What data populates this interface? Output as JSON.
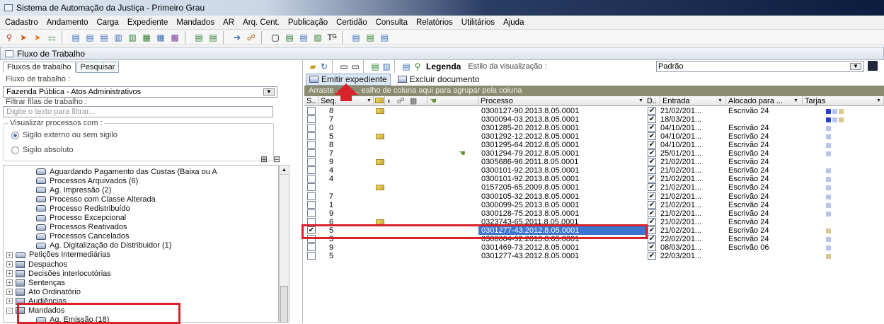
{
  "window": {
    "title": "Sistema de Automação da Justiça - Primeiro Grau"
  },
  "menu": [
    "Cadastro",
    "Andamento",
    "Carga",
    "Expediente",
    "Mandados",
    "AR",
    "Arq. Cent.",
    "Publicação",
    "Certidão",
    "Consulta",
    "Relatórios",
    "Utilitários",
    "Ajuda"
  ],
  "panel": {
    "title": "Fluxo de Trabalho"
  },
  "left": {
    "tabs": [
      "Fluxos de trabalho",
      "Pesquisar"
    ],
    "flow_label": "Fluxo de trabalho :",
    "flow_value": "Fazenda Pública - Atos Administrativos",
    "filter_label": "Filtrar filas de trabalho :",
    "filter_placeholder": "Digite o texto para filtrar...",
    "visualizar_label": "Visualizar processos com :",
    "radio_external": "Sigilo externo ou sem sigilo",
    "radio_absolute": "Sigilo absoluto",
    "tree": [
      {
        "label": "Aguardando Pagamento das Custas (Baixa ou A",
        "level": 2,
        "icon": "queue-icon"
      },
      {
        "label": "Processos Arquivados (6)",
        "level": 2,
        "icon": "queue-icon"
      },
      {
        "label": "Ag. Impressão (2)",
        "level": 2,
        "icon": "queue-icon"
      },
      {
        "label": "Processo com Classe Alterada",
        "level": 2,
        "icon": "queue-icon"
      },
      {
        "label": "Processo Redistribuído",
        "level": 2,
        "icon": "queue-icon"
      },
      {
        "label": "Processo Excepcional",
        "level": 2,
        "icon": "queue-icon"
      },
      {
        "label": "Processos Reativados",
        "level": 2,
        "icon": "queue-icon"
      },
      {
        "label": "Processos Cancelados",
        "level": 2,
        "icon": "queue-icon"
      },
      {
        "label": "Ag. Digitalização do Distribuidor (1)",
        "level": 2,
        "icon": "queue-icon"
      },
      {
        "label": "Petições Intermediárias",
        "level": 1,
        "icon": "queue-icon"
      },
      {
        "label": "Despachos",
        "level": 1,
        "icon": "folder-icon"
      },
      {
        "label": "Decisões interlocutórias",
        "level": 1,
        "icon": "folder-icon"
      },
      {
        "label": "Sentenças",
        "level": 1,
        "icon": "folder-icon"
      },
      {
        "label": "Ato Ordinatório",
        "level": 1,
        "icon": "folder-icon"
      },
      {
        "label": "Audiências",
        "level": 1,
        "icon": "folder-icon"
      },
      {
        "label": "Mandados",
        "level": 1,
        "icon": "folder-icon"
      },
      {
        "label": "Ag. Emissão (18)",
        "level": 2,
        "icon": "queue-icon"
      }
    ]
  },
  "right": {
    "legend_label": "Legenda",
    "style_label": "Estilo da visualização :",
    "style_value": "Padrão",
    "actions": {
      "emit": "Emitir expediente",
      "delete": "Excluir documento"
    },
    "group_hint": "Arraste ... ca... ealho de coluna aqui para agrupar pela coluna",
    "columns": {
      "s": "S..",
      "seq": "Seq.",
      "processo": "Processo",
      "d": "D..",
      "entrada": "Entrada",
      "alocado": "Alocado para ...",
      "tarjas": "Tarjas"
    },
    "rows": [
      {
        "checked": false,
        "seq": "8",
        "env": true,
        "proc": "0300127-90.2013.8.05.0001",
        "d": true,
        "entrada": "21/02/201...",
        "aloc": "Escrivão 24",
        "tarjas": [
          "#2a3fcf",
          "#b9c3f0",
          "#d8c98e"
        ]
      },
      {
        "checked": false,
        "seq": "7",
        "env": false,
        "proc": "0300094-03.2013.8.05.0001",
        "d": true,
        "entrada": "18/03/201...",
        "aloc": "",
        "tarjas": [
          "#2a3fcf",
          "#b9c3f0",
          "#d8c98e"
        ]
      },
      {
        "checked": false,
        "seq": "0",
        "env": false,
        "proc": "0301285-20.2012.8.05.0001",
        "d": true,
        "entrada": "04/10/201...",
        "aloc": "Escrivão 24",
        "tarjas": [
          "#b9c3f0"
        ]
      },
      {
        "checked": false,
        "seq": "5",
        "env": true,
        "proc": "0301292-12.2012.8.05.0001",
        "d": true,
        "entrada": "04/10/201...",
        "aloc": "Escrivão 24",
        "tarjas": [
          "#b9c3f0"
        ]
      },
      {
        "checked": false,
        "seq": "8",
        "env": false,
        "proc": "0301295-64.2012.8.05.0001",
        "d": true,
        "entrada": "04/10/201...",
        "aloc": "Escrivão 24",
        "tarjas": [
          "#b9c3f0"
        ]
      },
      {
        "checked": false,
        "seq": "7",
        "env": false,
        "hand": true,
        "proc": "0301294-79.2012.8.05.0001",
        "d": true,
        "entrada": "25/01/201...",
        "aloc": "Escrivão 24",
        "tarjas": [
          "#b9c3f0"
        ]
      },
      {
        "checked": false,
        "seq": "9",
        "env": true,
        "proc": "0305686-96.2011.8.05.0001",
        "d": true,
        "entrada": "21/02/201...",
        "aloc": "Escrivão 24",
        "tarjas": []
      },
      {
        "checked": false,
        "seq": "4",
        "env": false,
        "proc": "0300101-92.2013.8.05.0001",
        "d": true,
        "entrada": "21/02/201...",
        "aloc": "Escrivão 24",
        "tarjas": [
          "#b9c3f0"
        ]
      },
      {
        "checked": false,
        "seq": "4",
        "env": false,
        "proc": "0300101-92.2013.8.05.0001",
        "d": true,
        "entrada": "21/02/201...",
        "aloc": "Escrivão 24",
        "tarjas": [
          "#b9c3f0"
        ]
      },
      {
        "checked": false,
        "seq": "",
        "env": true,
        "proc": "0157205-65.2009.8.05.0001",
        "d": true,
        "entrada": "21/02/201...",
        "aloc": "Escrivão 24",
        "tarjas": [
          "#b9c3f0"
        ]
      },
      {
        "checked": false,
        "seq": "7",
        "env": false,
        "proc": "0300105-32.2013.8.05.0001",
        "d": true,
        "entrada": "21/02/201...",
        "aloc": "Escrivão 24",
        "tarjas": [
          "#b9c3f0"
        ]
      },
      {
        "checked": false,
        "seq": "1",
        "env": false,
        "proc": "0300099-25.2013.8.05.0001",
        "d": true,
        "entrada": "21/02/201...",
        "aloc": "Escrivão 24",
        "tarjas": [
          "#b9c3f0"
        ]
      },
      {
        "checked": false,
        "seq": "9",
        "env": false,
        "proc": "0300128-75.2013.8.05.0001",
        "d": true,
        "entrada": "21/02/201...",
        "aloc": "Escrivão 24",
        "tarjas": [
          "#b9c3f0"
        ]
      },
      {
        "checked": false,
        "seq": "6",
        "env": true,
        "proc": "0323743-65.2011.8.05.0001",
        "d": true,
        "entrada": "21/02/201...",
        "aloc": "Escrivão 24",
        "tarjas": []
      },
      {
        "checked": true,
        "seq": "5",
        "env": false,
        "proc": "0301277-43.2012.8.05.0001",
        "d": true,
        "entrada": "21/02/201...",
        "aloc": "Escrivão 24",
        "tarjas": [
          "#d8c98e"
        ],
        "selected": true
      },
      {
        "checked": false,
        "seq": "3",
        "env": false,
        "proc": "0300004-92.2013.8.05.0001",
        "d": true,
        "entrada": "22/02/201...",
        "aloc": "Escrivão 24",
        "tarjas": [
          "#b9c3f0"
        ]
      },
      {
        "checked": false,
        "seq": "9",
        "env": false,
        "proc": "0301469-73.2012.8.05.0001",
        "d": true,
        "entrada": "08/03/201...",
        "aloc": "Escrivão 06",
        "tarjas": [
          "#b9c3f0"
        ]
      },
      {
        "checked": false,
        "seq": "5",
        "env": false,
        "proc": "0301277-43.2012.8.05.0001",
        "d": true,
        "entrada": "22/03/201...",
        "aloc": "",
        "tarjas": [
          "#d8c98e"
        ]
      }
    ]
  }
}
